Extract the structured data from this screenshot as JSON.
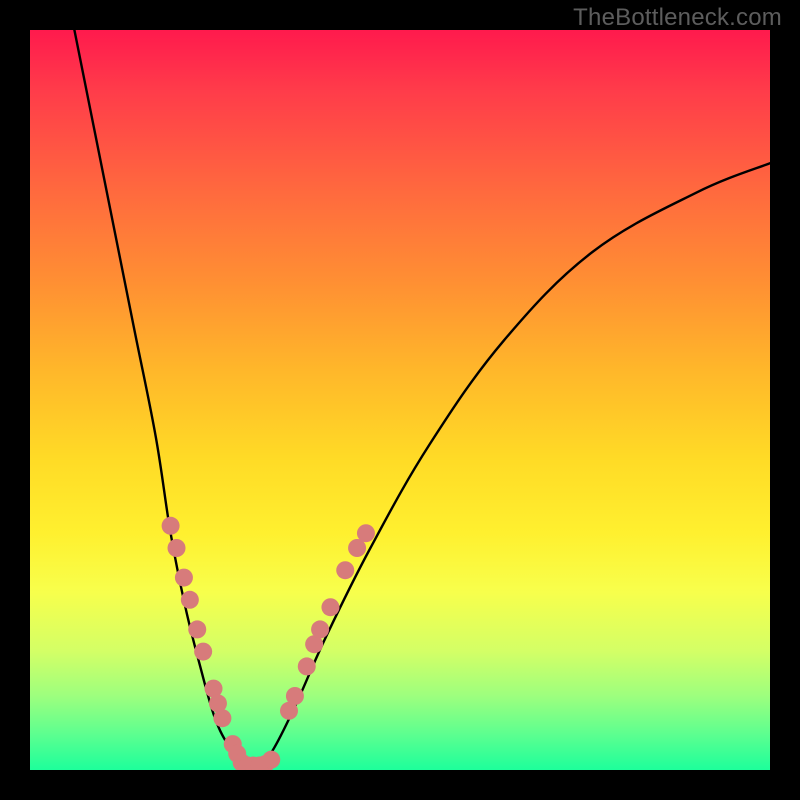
{
  "watermark": "TheBottleneck.com",
  "chart_data": {
    "type": "line",
    "title": "",
    "xlabel": "",
    "ylabel": "",
    "xlim": [
      0,
      100
    ],
    "ylim": [
      0,
      100
    ],
    "grid": false,
    "series": [
      {
        "name": "left-branch",
        "points": [
          {
            "x": 6,
            "y": 100
          },
          {
            "x": 10,
            "y": 80
          },
          {
            "x": 14,
            "y": 60
          },
          {
            "x": 17,
            "y": 45
          },
          {
            "x": 19,
            "y": 32
          },
          {
            "x": 21,
            "y": 22
          },
          {
            "x": 23,
            "y": 14
          },
          {
            "x": 25,
            "y": 7
          },
          {
            "x": 27,
            "y": 3
          },
          {
            "x": 29,
            "y": 0.5
          }
        ]
      },
      {
        "name": "right-branch",
        "points": [
          {
            "x": 29,
            "y": 0.5
          },
          {
            "x": 31,
            "y": 0.5
          },
          {
            "x": 33,
            "y": 3
          },
          {
            "x": 36,
            "y": 9
          },
          {
            "x": 40,
            "y": 18
          },
          {
            "x": 46,
            "y": 30
          },
          {
            "x": 54,
            "y": 44
          },
          {
            "x": 64,
            "y": 58
          },
          {
            "x": 76,
            "y": 70
          },
          {
            "x": 90,
            "y": 78
          },
          {
            "x": 100,
            "y": 82
          }
        ]
      }
    ],
    "marker_clusters": [
      {
        "name": "left-cluster",
        "color": "#d77b7b",
        "points": [
          {
            "x": 19.0,
            "y": 33
          },
          {
            "x": 19.8,
            "y": 30
          },
          {
            "x": 20.8,
            "y": 26
          },
          {
            "x": 21.6,
            "y": 23
          },
          {
            "x": 22.6,
            "y": 19
          },
          {
            "x": 23.4,
            "y": 16
          },
          {
            "x": 24.8,
            "y": 11
          },
          {
            "x": 25.4,
            "y": 9
          },
          {
            "x": 26.0,
            "y": 7
          },
          {
            "x": 27.4,
            "y": 3.5
          },
          {
            "x": 28.0,
            "y": 2.2
          }
        ]
      },
      {
        "name": "bottom-cluster",
        "color": "#d77b7b",
        "points": [
          {
            "x": 28.6,
            "y": 1.0
          },
          {
            "x": 29.4,
            "y": 0.6
          },
          {
            "x": 30.2,
            "y": 0.6
          },
          {
            "x": 31.0,
            "y": 0.6
          },
          {
            "x": 31.8,
            "y": 0.8
          },
          {
            "x": 32.6,
            "y": 1.4
          }
        ]
      },
      {
        "name": "right-cluster",
        "color": "#d77b7b",
        "points": [
          {
            "x": 35.0,
            "y": 8
          },
          {
            "x": 35.8,
            "y": 10
          },
          {
            "x": 37.4,
            "y": 14
          },
          {
            "x": 38.4,
            "y": 17
          },
          {
            "x": 39.2,
            "y": 19
          },
          {
            "x": 40.6,
            "y": 22
          },
          {
            "x": 42.6,
            "y": 27
          },
          {
            "x": 44.2,
            "y": 30
          },
          {
            "x": 45.4,
            "y": 32
          }
        ]
      }
    ]
  }
}
